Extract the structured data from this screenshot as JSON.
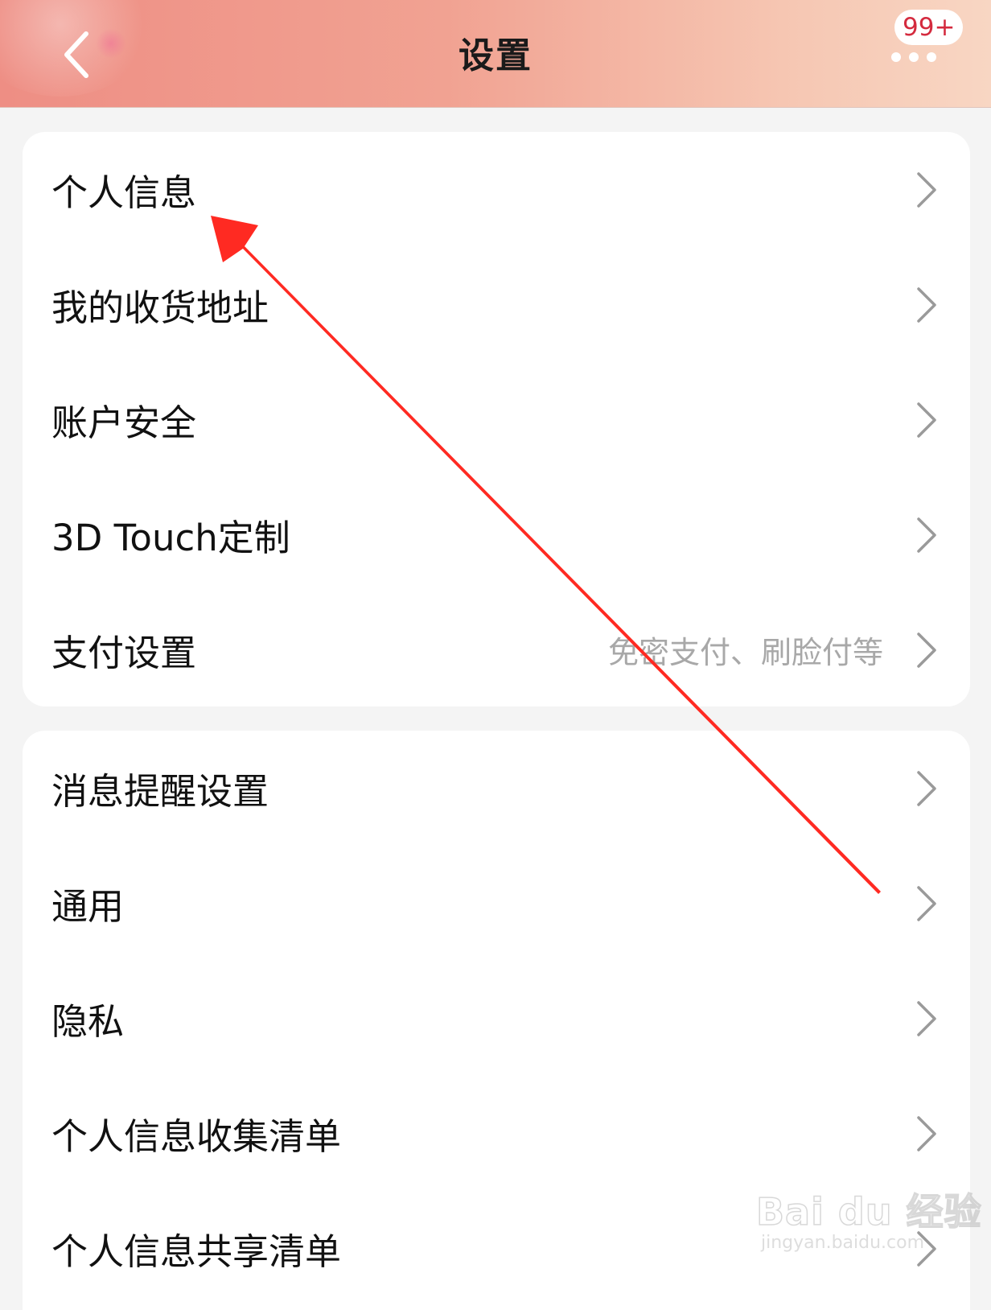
{
  "header": {
    "title": "设置",
    "badge": "99+",
    "back_icon": "chevron-left-icon",
    "more_icon": "more-dots-icon"
  },
  "group1": {
    "items": [
      {
        "label": "个人信息"
      },
      {
        "label": "我的收货地址"
      },
      {
        "label": "账户安全"
      },
      {
        "label": "3D Touch定制"
      },
      {
        "label": "支付设置",
        "sub": "免密支付、刷脸付等"
      }
    ]
  },
  "group2": {
    "items": [
      {
        "label": "消息提醒设置"
      },
      {
        "label": "通用"
      },
      {
        "label": "隐私"
      },
      {
        "label": "个人信息收集清单"
      },
      {
        "label": "个人信息共享清单"
      }
    ]
  },
  "watermark": {
    "main": "Bai du 经验",
    "sub": "jingyan.baidu.com"
  },
  "colors": {
    "header_gradient_start": "#ee8e84",
    "header_gradient_end": "#f8d6c3",
    "badge_text": "#d42a3e",
    "annotation_arrow": "#ff2a22",
    "chevron": "#9a9a9a",
    "background": "#f4f4f4"
  }
}
